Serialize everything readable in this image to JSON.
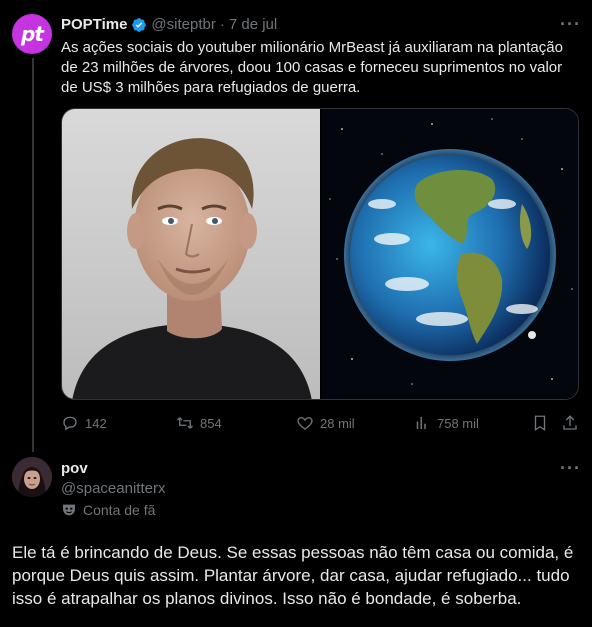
{
  "tweet": {
    "author_name": "POPTime",
    "author_handle": "@siteptbr",
    "separator": "·",
    "date": "7 de jul",
    "avatar_text": "pt",
    "more": "···",
    "text": "As ações sociais do youtuber milionário MrBeast já auxiliaram na plantação de 23 milhões de árvores, doou 100 casas e forneceu suprimentos no valor de US$ 3 milhões para refugiados de guerra.",
    "stats": {
      "replies": "142",
      "retweets": "854",
      "likes": "28 mil",
      "views": "758 mil"
    }
  },
  "reply": {
    "author_name": "pov",
    "author_handle": "@spaceanitterx",
    "badge": "Conta de fã",
    "more": "···",
    "text": "Ele tá é brincando de Deus. Se essas pessoas não têm casa ou comida, é porque Deus quis assim. Plantar árvore, dar casa, ajudar refugiado... tudo isso é atrapalhar os planos divinos. Isso não é bondade, é soberba."
  },
  "colors": {
    "background": "#000000",
    "text": "#e7e9ea",
    "muted": "#71767b",
    "verified": "#1d9bf0",
    "avatar": "#c633e0"
  }
}
